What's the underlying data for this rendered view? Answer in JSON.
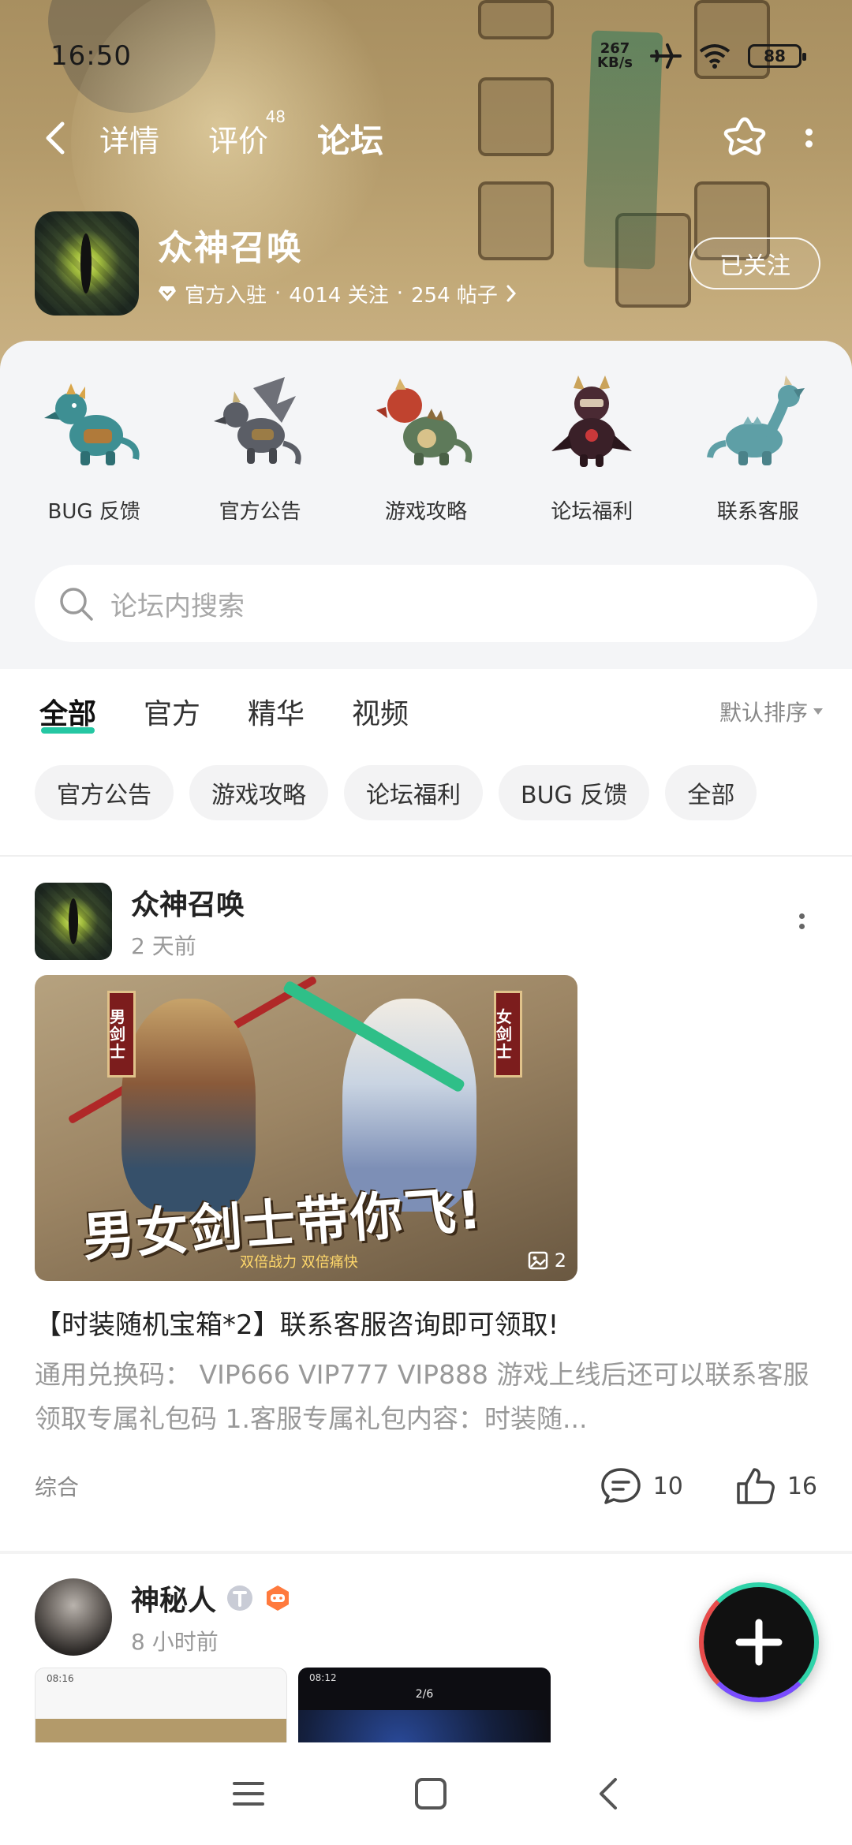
{
  "status_bar": {
    "time": "16:50",
    "net_speed_value": "267",
    "net_speed_unit": "KB/s",
    "battery": "88"
  },
  "top_nav": {
    "tabs": [
      {
        "label": "详情"
      },
      {
        "label": "评价",
        "badge": "48"
      },
      {
        "label": "论坛",
        "active": true
      }
    ]
  },
  "game": {
    "name": "众神召唤",
    "official": "官方入驻",
    "followers": "4014 关注",
    "posts": "254 帖子",
    "follow_label": "已关注"
  },
  "categories": [
    {
      "label": "BUG 反馈",
      "icon": "dragon-blue-icon",
      "color": "#3e8f93"
    },
    {
      "label": "官方公告",
      "icon": "dragon-winged-icon",
      "color": "#5b5e66"
    },
    {
      "label": "游戏攻略",
      "icon": "dragon-red-icon",
      "color": "#c0432f"
    },
    {
      "label": "论坛福利",
      "icon": "dragon-dark-icon",
      "color": "#4a2a33"
    },
    {
      "label": "联系客服",
      "icon": "dragon-teal-icon",
      "color": "#5e9fa6"
    }
  ],
  "search": {
    "placeholder": "论坛内搜索"
  },
  "filter_tabs": [
    {
      "label": "全部",
      "active": true
    },
    {
      "label": "官方"
    },
    {
      "label": "精华"
    },
    {
      "label": "视频"
    }
  ],
  "sort_label": "默认排序",
  "chips": [
    "官方公告",
    "游戏攻略",
    "论坛福利",
    "BUG 反馈",
    "全部"
  ],
  "posts": [
    {
      "author": "众神召唤",
      "time": "2 天前",
      "image": {
        "banner_left": "男剑士",
        "banner_right": "女剑士",
        "slogan": "男女剑士带你飞!",
        "subtitle": "双倍战力 双倍痛快",
        "image_count": "2"
      },
      "title": "【时装随机宝箱*2】联系客服咨询即可领取!",
      "body": "通用兑换码： VIP666 VIP777 VIP888 游戏上线后还可以联系客服领取专属礼包码 1.客服专属礼包内容：时装随...",
      "tag": "综合",
      "comments": "10",
      "likes": "16"
    },
    {
      "author": "神秘人",
      "time": "8 小时前",
      "thumb1_text": "08:16",
      "thumb2_text": "08:12",
      "thumb2_page": "2/6"
    }
  ],
  "colors": {
    "accent": "#25c7a3",
    "muted": "#999999"
  }
}
